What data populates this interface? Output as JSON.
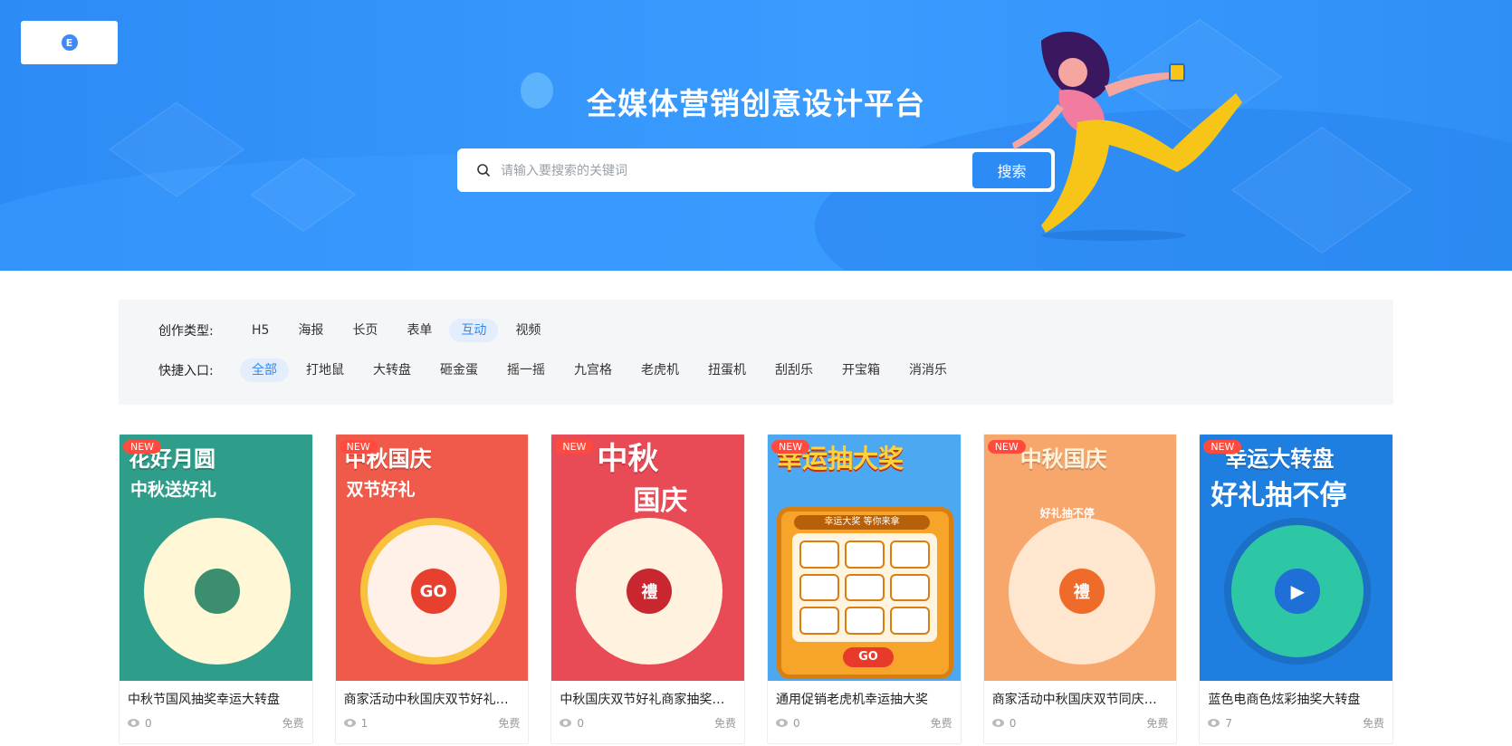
{
  "header": {
    "logo_glyph": "E",
    "title": "全媒体营销创意设计平台",
    "search": {
      "placeholder": "请输入要搜索的关键词",
      "button": "搜索"
    }
  },
  "filters": {
    "type_label": "创作类型:",
    "types": [
      "H5",
      "海报",
      "长页",
      "表单",
      "互动",
      "视频"
    ],
    "active_type": "互动",
    "entry_label": "快捷入口:",
    "entries": [
      "全部",
      "打地鼠",
      "大转盘",
      "砸金蛋",
      "摇一摇",
      "九宫格",
      "老虎机",
      "扭蛋机",
      "刮刮乐",
      "开宝箱",
      "消消乐"
    ],
    "active_entry": "全部"
  },
  "cards": [
    {
      "badge": "NEW",
      "thumb_title": "花好月圆",
      "thumb_sub": "中秋送好礼",
      "hub": "",
      "title": "中秋节国风抽奖幸运大转盘",
      "views": "0",
      "price": "免费",
      "bg": "#2e9e8a",
      "wheel": "#fff7d6",
      "hubcolor": "#3b8f6e"
    },
    {
      "badge": "NEW",
      "thumb_title": "中秋国庆",
      "thumb_sub": "双节好礼",
      "hub": "GO",
      "title": "商家活动中秋国庆双节好礼抽...",
      "views": "1",
      "price": "免费",
      "bg": "#f05a4a",
      "wheel": "#fff1e8",
      "hubcolor": "#e8402f"
    },
    {
      "badge": "NEW",
      "thumb_title": "中秋",
      "thumb_sub": "国庆",
      "hub": "禮",
      "title": "中秋国庆双节好礼商家抽奖活...",
      "views": "0",
      "price": "免费",
      "bg": "#e84b55",
      "wheel": "#fff3e0",
      "hubcolor": "#c9272f"
    },
    {
      "badge": "NEW",
      "thumb_title": "幸运抽大奖",
      "thumb_sub": "幸运大奖 等你来拿",
      "hub": "GO",
      "title": "通用促销老虎机幸运抽大奖",
      "views": "0",
      "price": "免费",
      "bg": "#4da8f2",
      "wheel": "",
      "hubcolor": "#e83a2a"
    },
    {
      "badge": "NEW",
      "thumb_title": "中秋国庆",
      "thumb_sub": "好礼抽不停",
      "hub": "禮",
      "title": "商家活动中秋国庆双节同庆抽...",
      "views": "0",
      "price": "免费",
      "bg": "#f7a66c",
      "wheel": "#ffe6cf",
      "hubcolor": "#ef6b2a"
    },
    {
      "badge": "NEW",
      "thumb_title": "幸运大转盘",
      "thumb_sub": "好礼抽不停",
      "hub": "▶",
      "title": "蓝色电商色炫彩抽奖大转盘",
      "views": "7",
      "price": "免费",
      "bg": "#1f7fe0",
      "wheel": "#2ec7a6",
      "hubcolor": "#1e6fd6"
    }
  ]
}
